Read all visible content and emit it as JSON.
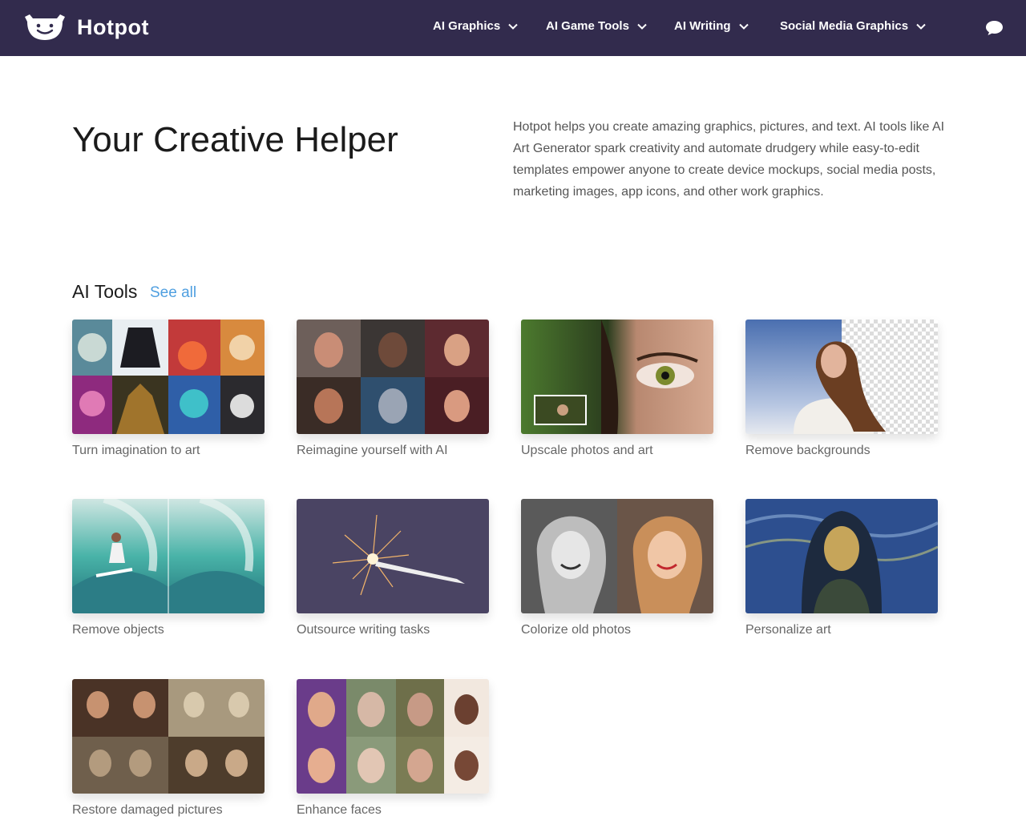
{
  "brand": {
    "name": "Hotpot"
  },
  "nav": {
    "items": [
      {
        "label": "AI Graphics"
      },
      {
        "label": "AI Game Tools"
      },
      {
        "label": "AI Writing"
      },
      {
        "label": "Social Media Graphics"
      }
    ]
  },
  "hero": {
    "title": "Your Creative Helper",
    "description": "Hotpot helps you create amazing graphics, pictures, and text. AI tools like AI Art Generator spark creativity and automate drudgery while easy-to-edit templates empower anyone to create device mockups, social media posts, marketing images, app icons, and other work graphics."
  },
  "tools_section": {
    "title": "AI Tools",
    "see_all": "See all",
    "cards": [
      {
        "label": "Turn imagination to art"
      },
      {
        "label": "Reimagine yourself with AI"
      },
      {
        "label": "Upscale photos and art"
      },
      {
        "label": "Remove backgrounds"
      },
      {
        "label": "Remove objects"
      },
      {
        "label": "Outsource writing tasks"
      },
      {
        "label": "Colorize old photos"
      },
      {
        "label": "Personalize art"
      },
      {
        "label": "Restore damaged pictures"
      },
      {
        "label": "Enhance faces"
      }
    ]
  },
  "colors": {
    "header_bg": "#322b4d",
    "link": "#4f9fe0",
    "label_text": "#666666"
  }
}
